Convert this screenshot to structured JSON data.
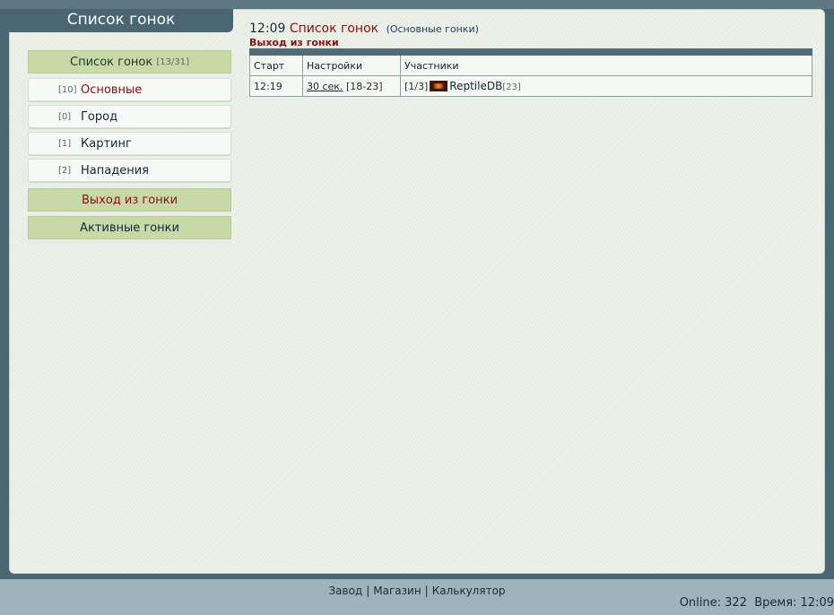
{
  "sidebar": {
    "header": "Список гонок",
    "race_list": {
      "label": "Список гонок",
      "count": "[13/31]"
    },
    "items": [
      {
        "count": "[10]",
        "label": "Основные"
      },
      {
        "count": "[0]",
        "label": "Город"
      },
      {
        "count": "[1]",
        "label": "Картинг"
      },
      {
        "count": "[2]",
        "label": "Нападения"
      }
    ],
    "exit_race": "Выход из гонки",
    "active_races": "Активные гонки"
  },
  "main": {
    "time": "12:09",
    "title": "Список гонок",
    "subtitle": "(Основные гонки)",
    "exit_link": "Выход из гонки",
    "table": {
      "headers": [
        "Старт",
        "Настройки",
        "Участники"
      ],
      "rows": [
        {
          "start": "12:19",
          "settings_time": "30 сек.",
          "settings_range": "[18-23]",
          "participants_count": "[1/3]",
          "player": "ReptileDB",
          "player_level": "[23]"
        }
      ]
    }
  },
  "footer": {
    "links": [
      "Завод",
      "Магазин",
      "Калькулятор"
    ],
    "status": "Online: 322  Время: 12:09"
  }
}
